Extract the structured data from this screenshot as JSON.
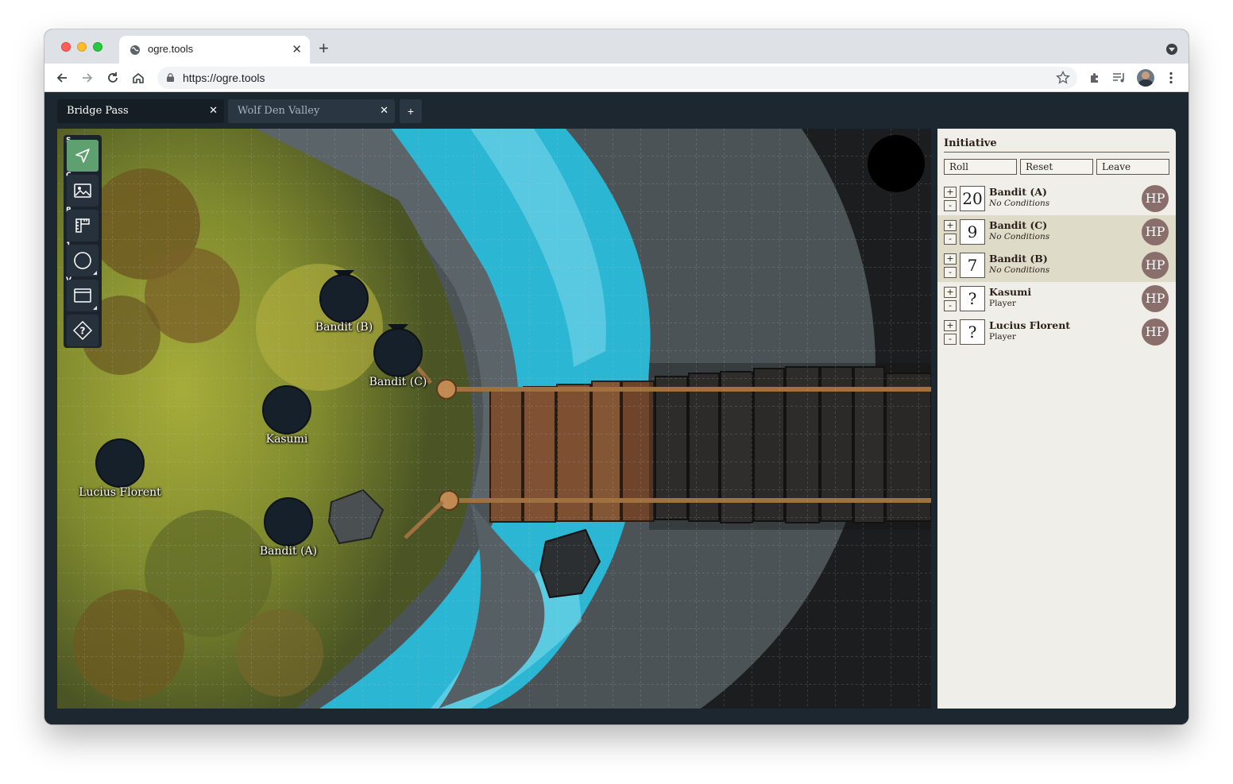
{
  "browser": {
    "tab_title": "ogre.tools",
    "url": "https://ogre.tools"
  },
  "map_tabs": [
    {
      "label": "Bridge Pass",
      "active": true
    },
    {
      "label": "Wolf Den Valley",
      "active": false
    }
  ],
  "add_map_label": "+",
  "tools": [
    {
      "key": "S",
      "icon": "select-arrow-icon"
    },
    {
      "key": "C",
      "icon": "image-icon"
    },
    {
      "key": "R",
      "icon": "ruler-icon"
    },
    {
      "key": "1",
      "icon": "circle-shape-icon"
    },
    {
      "key": "V",
      "icon": "window-icon"
    },
    {
      "key": "",
      "icon": "help-diamond-icon"
    }
  ],
  "tokens": [
    {
      "name": "Bandit (B)"
    },
    {
      "name": "Bandit (C)"
    },
    {
      "name": "Kasumi"
    },
    {
      "name": "Lucius Florent"
    },
    {
      "name": "Bandit (A)"
    }
  ],
  "initiative": {
    "title": "Initiative",
    "buttons": [
      "Roll",
      "Reset",
      "Leave"
    ],
    "combatants": [
      {
        "value": "20",
        "name": "Bandit (A)",
        "sub": "No Conditions",
        "highlight": false
      },
      {
        "value": "9",
        "name": "Bandit (C)",
        "sub": "No Conditions",
        "highlight": true
      },
      {
        "value": "7",
        "name": "Bandit (B)",
        "sub": "No Conditions",
        "highlight": true
      },
      {
        "value": "?",
        "name": "Kasumi",
        "sub": "Player",
        "highlight": false
      },
      {
        "value": "?",
        "name": "Lucius Florent",
        "sub": "Player",
        "highlight": false
      }
    ],
    "plus_label": "+",
    "minus_label": "-",
    "hp_label": "HP"
  },
  "colors": {
    "accent_tool": "#5fa070",
    "panel_bg": "#f0eee8",
    "highlight_row": "#dedcc9",
    "hp_badge": "#8a6e6c"
  }
}
